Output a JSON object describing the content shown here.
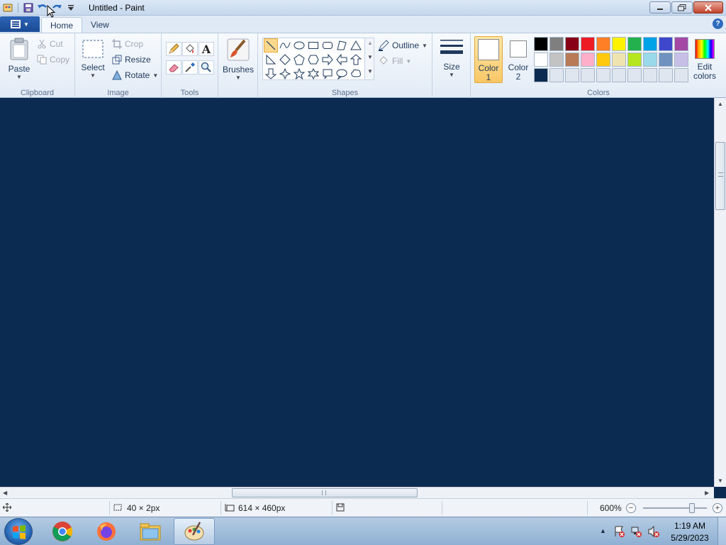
{
  "window": {
    "title": "Untitled - Paint",
    "qat_icons": [
      "paint-app-icon",
      "save-icon",
      "undo-icon",
      "redo-icon",
      "customize-qat-icon"
    ]
  },
  "ribbon": {
    "tabs": [
      {
        "label": "Home",
        "active": true
      },
      {
        "label": "View",
        "active": false
      }
    ],
    "clipboard": {
      "group_label": "Clipboard",
      "paste": "Paste",
      "cut": "Cut",
      "copy": "Copy"
    },
    "image": {
      "group_label": "Image",
      "select": "Select",
      "crop": "Crop",
      "resize": "Resize",
      "rotate": "Rotate"
    },
    "tools": {
      "group_label": "Tools",
      "items": [
        "pencil-icon",
        "fill-icon",
        "text-icon",
        "eraser-icon",
        "color-picker-icon",
        "magnifier-icon"
      ]
    },
    "brushes": {
      "label": "Brushes"
    },
    "shapes": {
      "group_label": "Shapes",
      "outline": "Outline",
      "fill": "Fill",
      "selected": "line"
    },
    "size": {
      "label": "Size"
    },
    "colors": {
      "group_label": "Colors",
      "color1_label_a": "Color",
      "color1_label_b": "1",
      "color2_label_a": "Color",
      "color2_label_b": "2",
      "color1": "#ffffff",
      "color2": "#ffffff",
      "edit_a": "Edit",
      "edit_b": "colors",
      "palette": [
        "#000000",
        "#7f7f7f",
        "#880015",
        "#ed1c24",
        "#ff7f27",
        "#fff200",
        "#22b14c",
        "#00a2e8",
        "#3f48cc",
        "#a349a4",
        "#ffffff",
        "#c3c3c3",
        "#b97a57",
        "#ffaec9",
        "#ffc90e",
        "#efe4b0",
        "#b5e61d",
        "#99d9ea",
        "#7092be",
        "#c8bfe7",
        "#0c2b50",
        "#dfe6ef",
        "#dfe6ef",
        "#dfe6ef",
        "#dfe6ef",
        "#dfe6ef",
        "#dfe6ef",
        "#dfe6ef",
        "#dfe6ef",
        "#dfe6ef"
      ]
    }
  },
  "canvas": {
    "color": "#0c2b50"
  },
  "status": {
    "selection_size": "40 × 2px",
    "image_size": "614 × 460px",
    "zoom": "600%"
  },
  "taskbar": {
    "apps": [
      "chrome-icon",
      "firefox-icon",
      "file-explorer-icon",
      "paint-icon"
    ],
    "time": "1:19 AM",
    "date": "5/29/2023"
  }
}
